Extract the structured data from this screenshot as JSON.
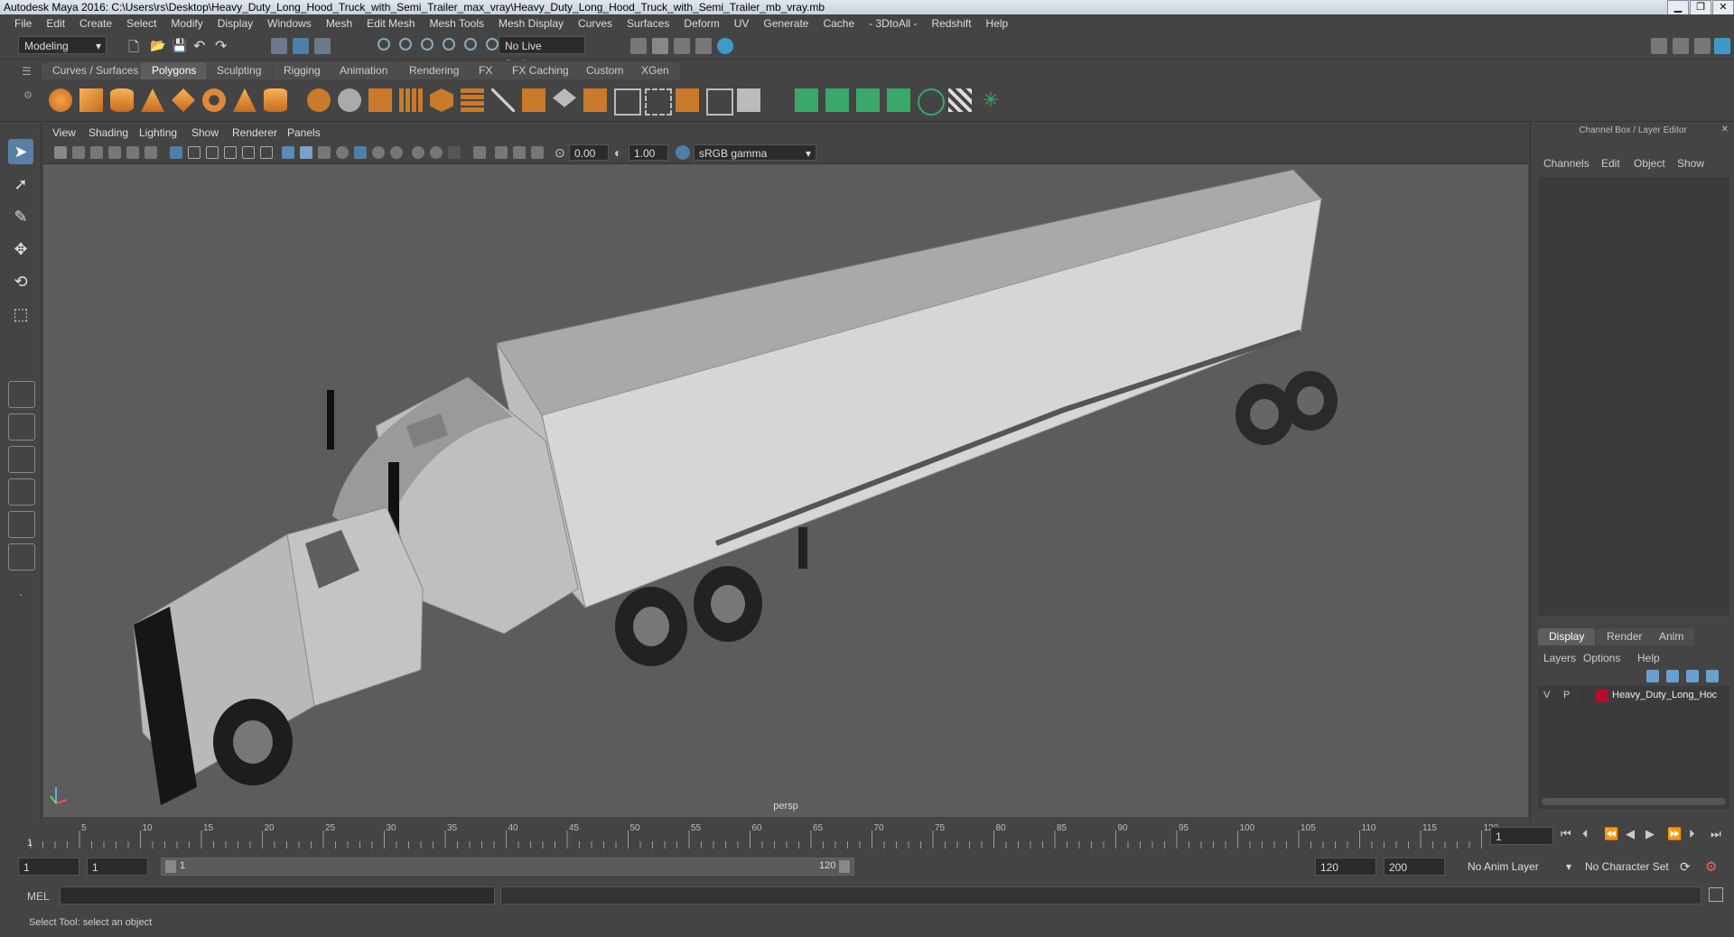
{
  "window": {
    "title": "Autodesk Maya 2016: C:\\Users\\rs\\Desktop\\Heavy_Duty_Long_Hood_Truck_with_Semi_Trailer_max_vray\\Heavy_Duty_Long_Hood_Truck_with_Semi_Trailer_mb_vray.mb",
    "minimize": "▁",
    "restore": "❐",
    "close": "✕"
  },
  "menu": [
    "File",
    "Edit",
    "Create",
    "Select",
    "Modify",
    "Display",
    "Windows",
    "Mesh",
    "Edit Mesh",
    "Mesh Tools",
    "Mesh Display",
    "Curves",
    "Surfaces",
    "Deform",
    "UV",
    "Generate",
    "Cache",
    "- 3DtoAll -",
    "Redshift",
    "Help"
  ],
  "statusline": {
    "mode": "Modeling",
    "live_surface": "No Live Surface"
  },
  "shelf_tabs": [
    "Curves / Surfaces",
    "Polygons",
    "Sculpting",
    "Rigging",
    "Animation",
    "Rendering",
    "FX",
    "FX Caching",
    "Custom",
    "XGen"
  ],
  "active_shelf": "Polygons",
  "viewport": {
    "menu": [
      "View",
      "Shading",
      "Lighting",
      "Show",
      "Renderer",
      "Panels"
    ],
    "exposure": "0.00",
    "gamma": "1.00",
    "color_space": "sRGB gamma",
    "camera": "persp"
  },
  "channel_box": {
    "title": "Channel Box / Layer Editor",
    "menu": [
      "Channels",
      "Edit",
      "Object",
      "Show"
    ]
  },
  "layer_editor": {
    "tabs": [
      "Display",
      "Render",
      "Anim"
    ],
    "menu": [
      "Layers",
      "Options",
      "Help"
    ],
    "layer": {
      "v": "V",
      "p": "P",
      "name": "Heavy_Duty_Long_Hoc",
      "color": "#b3102a"
    }
  },
  "timeline": {
    "ticks": [
      "5",
      "10",
      "15",
      "20",
      "25",
      "30",
      "35",
      "40",
      "45",
      "50",
      "55",
      "60",
      "65",
      "70",
      "75",
      "80",
      "85",
      "90",
      "95",
      "100",
      "105",
      "110",
      "115",
      "120"
    ],
    "current_frame_marker": "1",
    "current_frame": "1"
  },
  "range": {
    "start": "1",
    "playback_start": "1",
    "slider_start": "1",
    "slider_end": "120",
    "playback_end": "120",
    "end": "200",
    "anim_layer": "No Anim Layer",
    "character_set": "No Character Set"
  },
  "command": {
    "label": "MEL"
  },
  "help_line": "Select Tool: select an object"
}
